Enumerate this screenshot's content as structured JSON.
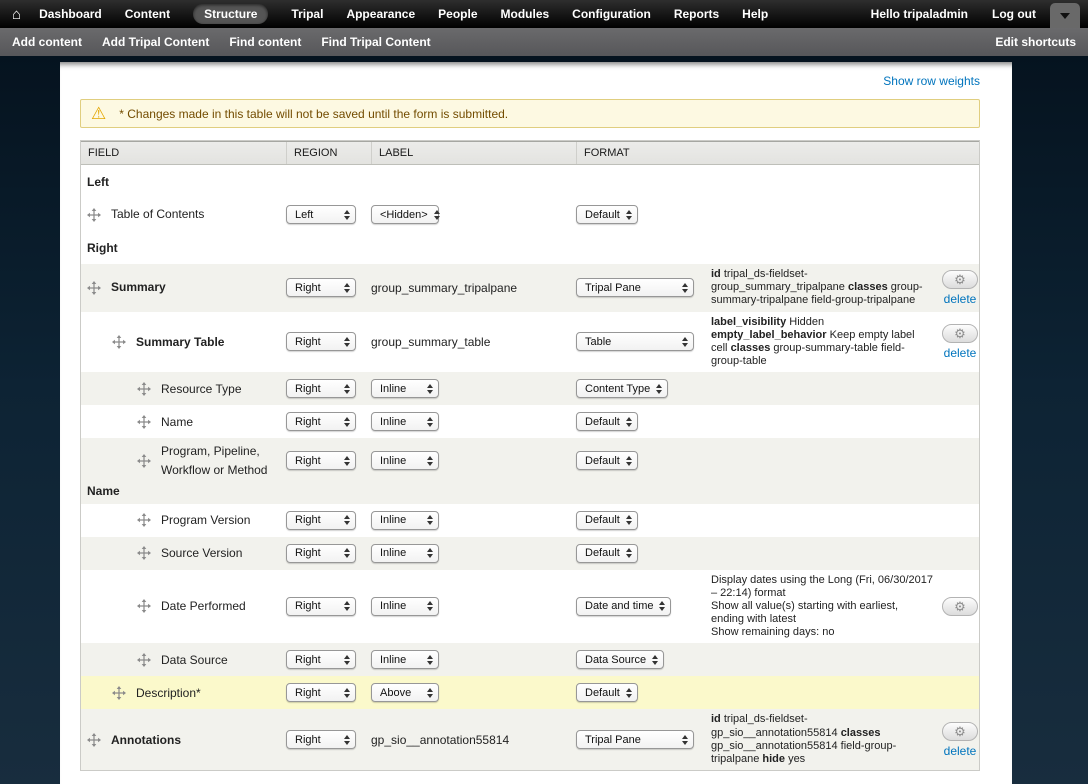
{
  "icons": {
    "home": "⌂",
    "warning": "⚠",
    "gear": "⚙"
  },
  "colors": {
    "link": "#0074bd",
    "warning_bg": "#fdf9e2",
    "warning_border": "#e0ce7f",
    "warning_text": "#734c00",
    "row_gray": "#f2f2ed",
    "row_highlight": "#fbf9cb",
    "background": "#0d2334"
  },
  "admin_bar": {
    "home_icon": "⌂",
    "items": [
      "Dashboard",
      "Content",
      "Structure",
      "Tripal",
      "Appearance",
      "People",
      "Modules",
      "Configuration",
      "Reports",
      "Help"
    ],
    "active_item": "Structure",
    "greeting": "Hello tripaladmin",
    "logout": "Log out"
  },
  "shortcut_bar": {
    "items": [
      "Add content",
      "Add Tripal Content",
      "Find content",
      "Find Tripal Content"
    ],
    "edit_label": "Edit shortcuts"
  },
  "page": {
    "show_row_weights": "Show row weights",
    "warning": "* Changes made in this table will not be saved until the form is submitted.",
    "table": {
      "headers": [
        "FIELD",
        "REGION",
        "LABEL",
        "FORMAT"
      ],
      "rows": [
        {
          "kind": "group",
          "label": "Left",
          "bg": "white"
        },
        {
          "kind": "field",
          "name": "Table of Contents",
          "indent": 0,
          "bold": false,
          "bg": "white",
          "region": "Left",
          "label": {
            "type": "select",
            "value": "<Hidden>"
          },
          "format": {
            "value": "Default",
            "wide": false
          }
        },
        {
          "kind": "group",
          "label": "Right",
          "bg": "white"
        },
        {
          "kind": "field",
          "name": "Summary",
          "indent": 0,
          "bold": true,
          "bg": "gray",
          "region": "Right",
          "label": {
            "type": "text",
            "value": "group_summary_tripalpane"
          },
          "format": {
            "value": "Tripal Pane",
            "wide": true
          },
          "desc": [
            {
              "b": "id",
              "t": "tripal_ds-fieldset-group_summary_tripalpane"
            },
            {
              "b": "classes",
              "t": "group-summary-tripalpane field-group-tripalpane"
            }
          ],
          "gear": true,
          "del": "delete"
        },
        {
          "kind": "field",
          "name": "Summary Table",
          "indent": 1,
          "bold": true,
          "bg": "white",
          "region": "Right",
          "label": {
            "type": "text",
            "value": "group_summary_table"
          },
          "format": {
            "value": "Table",
            "wide": true
          },
          "desc": [
            {
              "b": "label_visibility",
              "t": "Hidden"
            },
            {
              "b": "empty_label_behavior",
              "t": "Keep empty label cell"
            },
            {
              "b": "classes",
              "t": "group-summary-table field-group-table"
            }
          ],
          "gear": true,
          "del": "delete"
        },
        {
          "kind": "field",
          "name": "Resource Type",
          "indent": 2,
          "bold": false,
          "bg": "gray",
          "region": "Right",
          "label": {
            "type": "select",
            "value": "Inline"
          },
          "format": {
            "value": "Content Type",
            "wide": false
          }
        },
        {
          "kind": "field",
          "name": "Name",
          "indent": 2,
          "bold": false,
          "bg": "white",
          "region": "Right",
          "label": {
            "type": "select",
            "value": "Inline"
          },
          "format": {
            "value": "Default",
            "wide": false
          }
        },
        {
          "kind": "field",
          "name": "Program, Pipeline, Workflow or Method",
          "indent": 2,
          "bold": false,
          "bg": "gray",
          "region": "Right",
          "label": {
            "type": "select",
            "value": "Inline"
          },
          "format": {
            "value": "Default",
            "wide": false
          },
          "sub_label": "Name"
        },
        {
          "kind": "field",
          "name": "Program Version",
          "indent": 2,
          "bold": false,
          "bg": "white",
          "region": "Right",
          "label": {
            "type": "select",
            "value": "Inline"
          },
          "format": {
            "value": "Default",
            "wide": false
          }
        },
        {
          "kind": "field",
          "name": "Source Version",
          "indent": 2,
          "bold": false,
          "bg": "gray",
          "region": "Right",
          "label": {
            "type": "select",
            "value": "Inline"
          },
          "format": {
            "value": "Default",
            "wide": false
          }
        },
        {
          "kind": "field",
          "name": "Date Performed",
          "indent": 2,
          "bold": false,
          "bg": "white",
          "region": "Right",
          "label": {
            "type": "select",
            "value": "Inline"
          },
          "format": {
            "value": "Date and time",
            "wide": false
          },
          "desc": [
            {
              "t": "Display dates using the Long (Fri, 06/30/2017 – 22:14) format",
              "block": true
            },
            {
              "t": "Show all value(s) starting with earliest, ending with latest",
              "block": true
            },
            {
              "t": "Show remaining days: no",
              "block": true
            }
          ],
          "gear": true
        },
        {
          "kind": "field",
          "name": "Data Source",
          "indent": 2,
          "bold": false,
          "bg": "gray",
          "region": "Right",
          "label": {
            "type": "select",
            "value": "Inline"
          },
          "format": {
            "value": "Data Source",
            "wide": false
          }
        },
        {
          "kind": "field",
          "name": "Description*",
          "indent": 1,
          "bold": false,
          "bg": "yellow",
          "region": "Right",
          "label": {
            "type": "select",
            "value": "Above"
          },
          "format": {
            "value": "Default",
            "wide": false
          }
        },
        {
          "kind": "field",
          "name": "Annotations",
          "indent": 0,
          "bold": true,
          "bg": "gray",
          "region": "Right",
          "label": {
            "type": "text",
            "value": "gp_sio__annotation55814"
          },
          "format": {
            "value": "Tripal Pane",
            "wide": true
          },
          "desc": [
            {
              "b": "id",
              "t": "tripal_ds-fieldset-gp_sio__annotation55814"
            },
            {
              "b": "classes",
              "t": "gp_sio__annotation55814 field-group-tripalpane"
            },
            {
              "b": "hide",
              "t": "yes"
            }
          ],
          "gear": true,
          "del": "delete"
        }
      ]
    }
  }
}
